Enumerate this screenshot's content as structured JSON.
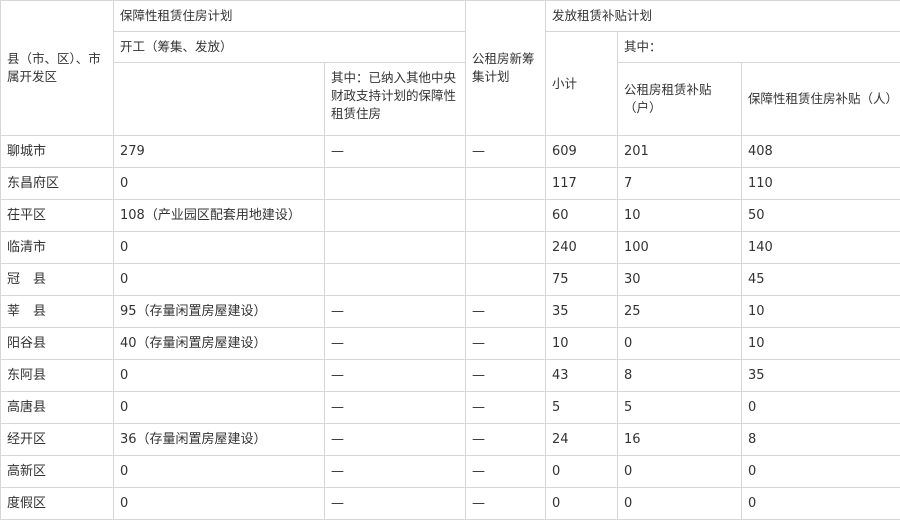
{
  "table": {
    "header": {
      "region": "县（市、区）、市属开发区",
      "plan_group": "保障性租赁住房计划",
      "start": "开工（筹集、发放）",
      "central_support": "其中：已纳入其他中央财政支持计划的保障性租赁住房",
      "public_rental_plan": "公租房新筹集计划",
      "subsidy_group": "发放租赁补贴计划",
      "subtotal": "小计",
      "among": "其中：",
      "public_subsidy": "公租房租赁补贴（户）",
      "guaranteed_subsidy": "保障性租赁住房补贴（人）"
    },
    "rows": [
      {
        "region": "聊城市",
        "start": "279",
        "central": "—",
        "public": "—",
        "subtotal": "609",
        "public_sub": "201",
        "guar_sub": "408"
      },
      {
        "region": "东昌府区",
        "start": "0",
        "central": "",
        "public": "",
        "subtotal": "117",
        "public_sub": "7",
        "guar_sub": "110"
      },
      {
        "region": "茌平区",
        "start": "108（产业园区配套用地建设）",
        "central": "",
        "public": "",
        "subtotal": "60",
        "public_sub": "10",
        "guar_sub": "50"
      },
      {
        "region": "临清市",
        "start": "0",
        "central": "",
        "public": "",
        "subtotal": "240",
        "public_sub": "100",
        "guar_sub": "140"
      },
      {
        "region": "冠　县",
        "start": "0",
        "central": "",
        "public": "",
        "subtotal": "75",
        "public_sub": "30",
        "guar_sub": "45"
      },
      {
        "region": "莘　县",
        "start": "95（存量闲置房屋建设）",
        "central": "—",
        "public": "—",
        "subtotal": "35",
        "public_sub": "25",
        "guar_sub": "10"
      },
      {
        "region": "阳谷县",
        "start": "40（存量闲置房屋建设）",
        "central": "—",
        "public": "—",
        "subtotal": "10",
        "public_sub": "0",
        "guar_sub": "10"
      },
      {
        "region": "东阿县",
        "start": "0",
        "central": "—",
        "public": "—",
        "subtotal": "43",
        "public_sub": "8",
        "guar_sub": "35"
      },
      {
        "region": "高唐县",
        "start": "0",
        "central": "—",
        "public": "—",
        "subtotal": "5",
        "public_sub": "5",
        "guar_sub": "0"
      },
      {
        "region": "经开区",
        "start": "36（存量闲置房屋建设）",
        "central": "—",
        "public": "—",
        "subtotal": "24",
        "public_sub": "16",
        "guar_sub": "8"
      },
      {
        "region": "高新区",
        "start": "0",
        "central": "—",
        "public": "—",
        "subtotal": "0",
        "public_sub": "0",
        "guar_sub": "0"
      },
      {
        "region": "度假区",
        "start": "0",
        "central": "—",
        "public": "—",
        "subtotal": "0",
        "public_sub": "0",
        "guar_sub": "0"
      }
    ]
  }
}
